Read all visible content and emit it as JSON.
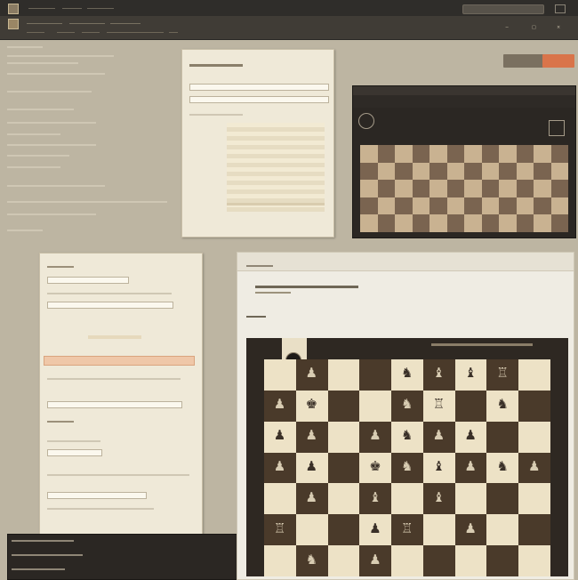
{
  "topbar": {
    "menu_items": [],
    "toolbar_items": [],
    "window_controls": [
      "−",
      "□",
      "×"
    ]
  },
  "status": {
    "left_button_label": "",
    "right_button_label": ""
  },
  "small_board": {
    "label": ""
  },
  "main_board": {
    "rows": [
      [
        "",
        "♟",
        "",
        "",
        "♞",
        "♝",
        "♝",
        "♖",
        ""
      ],
      [
        "♟",
        "♚",
        "",
        "",
        "♞",
        "♖",
        "",
        "♞",
        ""
      ],
      [
        "♟",
        "♟",
        "",
        "♟",
        "♞",
        "♟",
        "♟",
        "",
        ""
      ],
      [
        "♟",
        "♟",
        "",
        "♚",
        "♞",
        "♝",
        "♟",
        "♞",
        "♟"
      ],
      [
        "",
        "♟",
        "",
        "♝",
        "",
        "♝",
        "",
        "",
        ""
      ],
      [
        "♖",
        "",
        "",
        "♟",
        "♖",
        "",
        "♟",
        "",
        ""
      ],
      [
        "",
        "♞",
        "",
        "♟",
        "",
        "",
        "",
        "",
        ""
      ]
    ]
  },
  "colors": {
    "light_square": "#ede2c6",
    "dark_square": "#4a3a2a",
    "accent": "#d9744a",
    "board_frame": "#2e2822"
  }
}
